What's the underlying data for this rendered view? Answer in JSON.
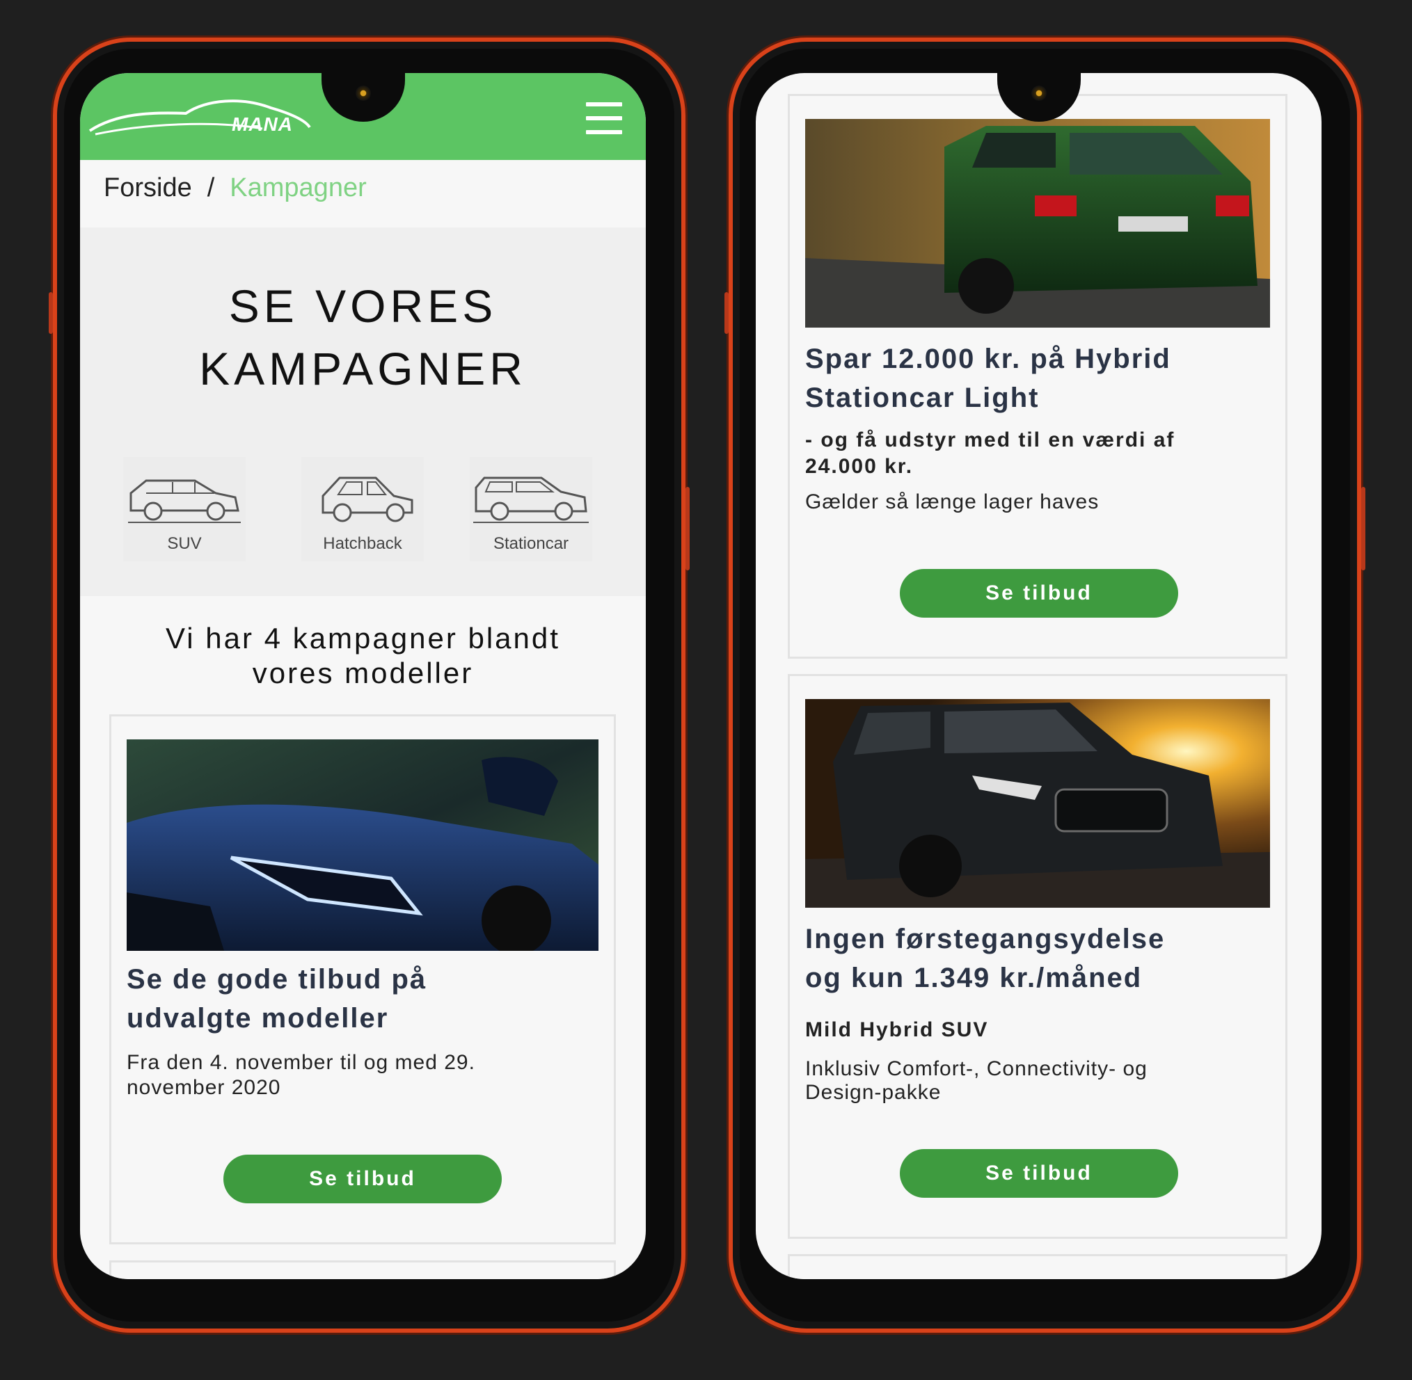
{
  "left_phone": {
    "logo_text": "MANA",
    "breadcrumb": {
      "home": "Forside",
      "separator": "/",
      "current": "Kampagner"
    },
    "hero_title_line1": "SE VORES",
    "hero_title_line2": "KAMPAGNER",
    "categories": [
      {
        "label": "SUV",
        "icon": "suv-car-icon"
      },
      {
        "label": "Hatchback",
        "icon": "hatchback-car-icon"
      },
      {
        "label": "Stationcar",
        "icon": "stationcar-car-icon"
      }
    ],
    "count_line1": "Vi har 4 kampagner blandt",
    "count_line2": "vores modeller",
    "card": {
      "title_line1": "Se de gode tilbud på",
      "title_line2": "udvalgte modeller",
      "text_line1": "Fra den 4. november til og med 29.",
      "text_line2": "november 2020",
      "button": "Se tilbud"
    }
  },
  "right_phone": {
    "card1": {
      "title_line1": "Spar 12.000 kr. på Hybrid",
      "title_line2": "Stationcar Light",
      "sub_line1": "- og få udstyr med til en værdi af",
      "sub_line2": "24.000 kr.",
      "text": "Gælder så længe lager haves",
      "button": "Se tilbud"
    },
    "card2": {
      "title_line1": "Ingen førstegangsydelse",
      "title_line2": "og kun 1.349 kr./måned",
      "sub": "Mild Hybrid SUV",
      "text_line1": "Inklusiv Comfort-, Connectivity- og",
      "text_line2": "Design-pakke",
      "button": "Se tilbud"
    }
  },
  "colors": {
    "brand_green": "#5cc563",
    "button_green": "#3e9b3f",
    "breadcrumb_active": "#7fd283",
    "phone_frame": "#d9421a",
    "background": "#1f1f1f"
  }
}
